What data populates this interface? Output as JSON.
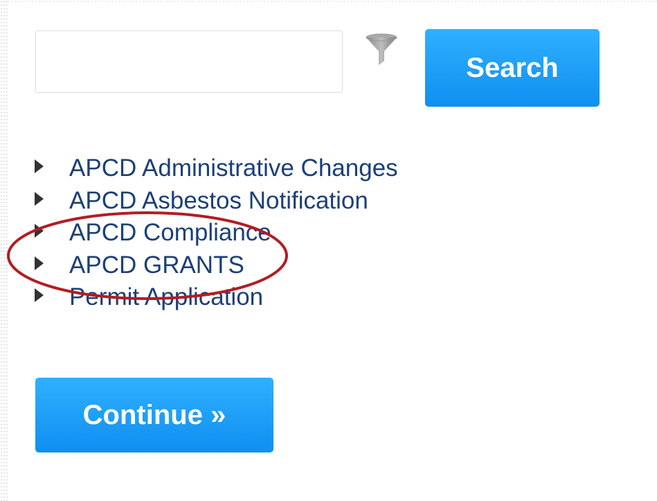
{
  "search": {
    "value": "",
    "placeholder": "",
    "button_label": "Search",
    "filter_icon": "funnel-filter-icon"
  },
  "record_types": [
    {
      "label": "APCD Administrative Changes",
      "icon": "triangle-right-icon"
    },
    {
      "label": "APCD Asbestos Notification",
      "icon": "triangle-right-icon"
    },
    {
      "label": "APCD Compliance",
      "icon": "triangle-right-icon"
    },
    {
      "label": "APCD GRANTS",
      "icon": "triangle-right-icon"
    },
    {
      "label": "Permit Application",
      "icon": "triangle-right-icon"
    }
  ],
  "continue": {
    "button_label": "Continue »"
  },
  "annotation": {
    "shape": "ellipse",
    "color": "#b01e23"
  },
  "colors": {
    "button_gradient_top": "#2fb0ff",
    "button_gradient_bottom": "#0f8ff0",
    "link_text": "#1c3f77",
    "arrow": "#333333"
  }
}
